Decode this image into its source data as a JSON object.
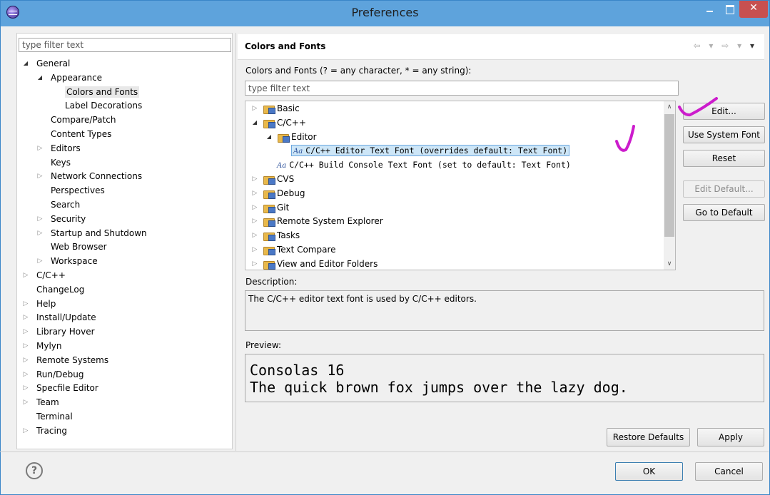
{
  "window": {
    "title": "Preferences",
    "close_glyph": "✕"
  },
  "left": {
    "filter_placeholder": "type filter text",
    "tree": [
      {
        "label": "General",
        "level": 0,
        "state": "expanded"
      },
      {
        "label": "Appearance",
        "level": 1,
        "state": "expanded"
      },
      {
        "label": "Colors and Fonts",
        "level": 2,
        "state": "leaf",
        "selected": true
      },
      {
        "label": "Label Decorations",
        "level": 2,
        "state": "leaf"
      },
      {
        "label": "Compare/Patch",
        "level": 1,
        "state": "leaf"
      },
      {
        "label": "Content Types",
        "level": 1,
        "state": "leaf"
      },
      {
        "label": "Editors",
        "level": 1,
        "state": "collapsed"
      },
      {
        "label": "Keys",
        "level": 1,
        "state": "leaf"
      },
      {
        "label": "Network Connections",
        "level": 1,
        "state": "collapsed"
      },
      {
        "label": "Perspectives",
        "level": 1,
        "state": "leaf"
      },
      {
        "label": "Search",
        "level": 1,
        "state": "leaf"
      },
      {
        "label": "Security",
        "level": 1,
        "state": "collapsed"
      },
      {
        "label": "Startup and Shutdown",
        "level": 1,
        "state": "collapsed"
      },
      {
        "label": "Web Browser",
        "level": 1,
        "state": "leaf"
      },
      {
        "label": "Workspace",
        "level": 1,
        "state": "collapsed"
      },
      {
        "label": "C/C++",
        "level": 0,
        "state": "collapsed"
      },
      {
        "label": "ChangeLog",
        "level": 0,
        "state": "leaf"
      },
      {
        "label": "Help",
        "level": 0,
        "state": "collapsed"
      },
      {
        "label": "Install/Update",
        "level": 0,
        "state": "collapsed"
      },
      {
        "label": "Library Hover",
        "level": 0,
        "state": "collapsed"
      },
      {
        "label": "Mylyn",
        "level": 0,
        "state": "collapsed"
      },
      {
        "label": "Remote Systems",
        "level": 0,
        "state": "collapsed"
      },
      {
        "label": "Run/Debug",
        "level": 0,
        "state": "collapsed"
      },
      {
        "label": "Specfile Editor",
        "level": 0,
        "state": "collapsed"
      },
      {
        "label": "Team",
        "level": 0,
        "state": "collapsed"
      },
      {
        "label": "Terminal",
        "level": 0,
        "state": "leaf"
      },
      {
        "label": "Tracing",
        "level": 0,
        "state": "collapsed"
      }
    ]
  },
  "page": {
    "title": "Colors and Fonts",
    "nav_back": "⇦ ▾",
    "nav_forward": "⇨ ▾",
    "nav_menu": "▾",
    "intro": "Colors and Fonts (? = any character, * = any string):",
    "filter_placeholder": "type filter text",
    "font_tree": [
      {
        "label": "Basic",
        "level": 0,
        "state": "collapsed",
        "kind": "folder"
      },
      {
        "label": "C/C++",
        "level": 0,
        "state": "expanded",
        "kind": "folder"
      },
      {
        "label": "Editor",
        "level": 1,
        "state": "expanded",
        "kind": "folder"
      },
      {
        "label": "C/C++ Editor Text Font (overrides default: Text Font)",
        "level": 2,
        "state": "leaf",
        "kind": "font",
        "selected": true
      },
      {
        "label": "C/C++ Build Console Text Font (set to default: Text Font)",
        "level": 1,
        "state": "leaf",
        "kind": "font"
      },
      {
        "label": "CVS",
        "level": 0,
        "state": "collapsed",
        "kind": "folder"
      },
      {
        "label": "Debug",
        "level": 0,
        "state": "collapsed",
        "kind": "folder"
      },
      {
        "label": "Git",
        "level": 0,
        "state": "collapsed",
        "kind": "folder"
      },
      {
        "label": "Remote System Explorer",
        "level": 0,
        "state": "collapsed",
        "kind": "folder"
      },
      {
        "label": "Tasks",
        "level": 0,
        "state": "collapsed",
        "kind": "folder"
      },
      {
        "label": "Text Compare",
        "level": 0,
        "state": "collapsed",
        "kind": "folder"
      },
      {
        "label": "View and Editor Folders",
        "level": 0,
        "state": "collapsed",
        "kind": "folder"
      }
    ],
    "font_icon_text": "Aa",
    "buttons": {
      "edit": "Edit...",
      "use_system_font": "Use System Font",
      "reset": "Reset",
      "edit_default": "Edit Default...",
      "go_to_default": "Go to Default"
    },
    "description_label": "Description:",
    "description_text": "The C/C++ editor text font is used by C/C++ editors.",
    "preview_label": "Preview:",
    "preview_lines": [
      "Consolas 16",
      "The quick brown fox jumps over the lazy dog."
    ],
    "restore_defaults": "Restore Defaults",
    "apply": "Apply"
  },
  "footer": {
    "help_glyph": "?",
    "ok": "OK",
    "cancel": "Cancel"
  },
  "annotation_color": "#cc1ccc"
}
